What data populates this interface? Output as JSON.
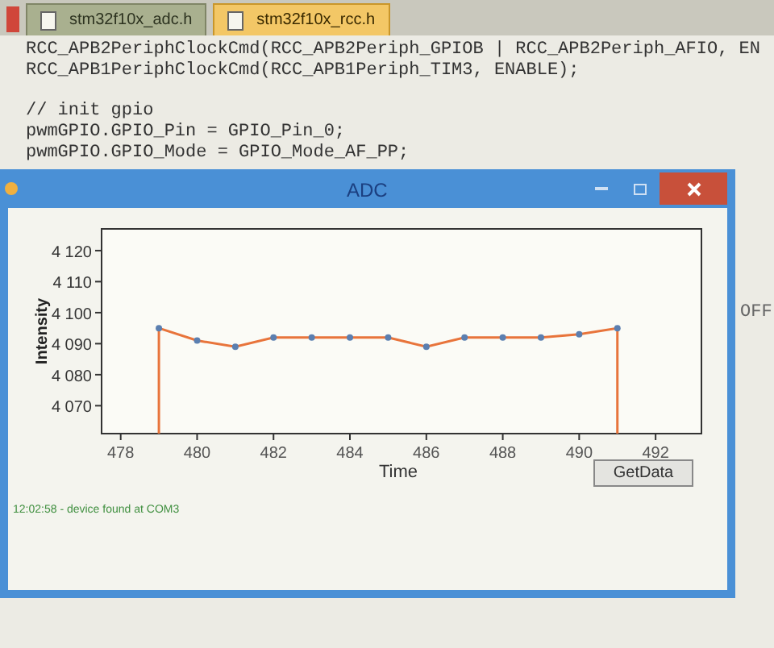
{
  "editor": {
    "tabs": [
      {
        "label": "stm32f10x_adc.h",
        "selected": false
      },
      {
        "label": "stm32f10x_rcc.h",
        "selected": true
      }
    ],
    "code_blocks": [
      [
        "RCC_APB2PeriphClockCmd(RCC_APB2Periph_GPIOB | RCC_APB2Periph_AFIO, EN",
        "RCC_APB1PeriphClockCmd(RCC_APB1Periph_TIM3, ENABLE);"
      ],
      [
        "// init gpio",
        "pwmGPIO.GPIO_Pin = GPIO_Pin_0;",
        "pwmGPIO.GPIO_Mode = GPIO_Mode_AF_PP;"
      ]
    ],
    "side_text": "OFF"
  },
  "window": {
    "title": "ADC",
    "chart_data": {
      "type": "line",
      "xlabel": "Time",
      "ylabel": "Intensity",
      "x": [
        479,
        480,
        481,
        482,
        483,
        484,
        485,
        486,
        487,
        488,
        489,
        490,
        491
      ],
      "series": [
        {
          "color": "#e8743b",
          "marker": "circle",
          "values": [
            4095,
            4091,
            4089,
            4092,
            4092,
            4092,
            4092,
            4089,
            4092,
            4092,
            4092,
            4093,
            4095
          ]
        }
      ],
      "ref_lines": [
        {
          "axis": "x",
          "value": 479,
          "color": "#e8743b"
        },
        {
          "axis": "x",
          "value": 491,
          "color": "#e8743b"
        }
      ],
      "xlim": [
        477.5,
        493.2
      ],
      "ylim": [
        4061,
        4127
      ],
      "xticks": [
        478,
        480,
        482,
        484,
        486,
        488,
        490,
        492
      ],
      "yticks": [
        {
          "value": 4070,
          "label": "4 070"
        },
        {
          "value": 4080,
          "label": "4 080"
        },
        {
          "value": 4090,
          "label": "4 090"
        },
        {
          "value": 4100,
          "label": "4 100"
        },
        {
          "value": 4110,
          "label": "4 110"
        },
        {
          "value": 4120,
          "label": "4 120"
        }
      ]
    },
    "button": "GetData",
    "status": "12:02:58 - device found at COM3"
  }
}
